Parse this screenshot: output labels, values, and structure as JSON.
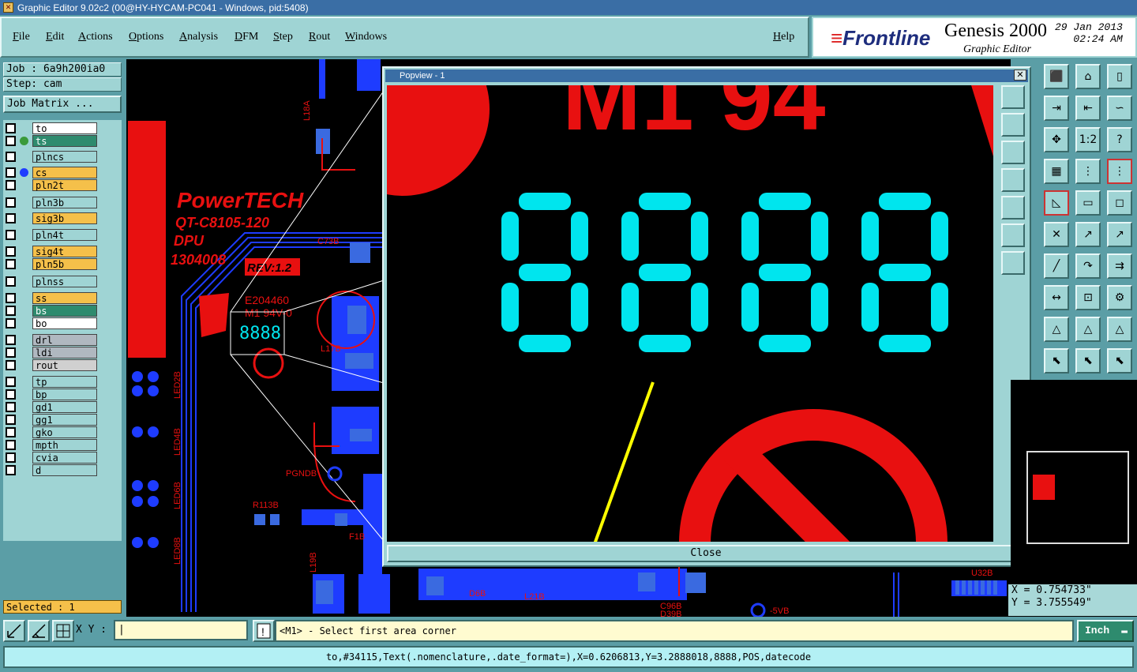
{
  "window": {
    "title": "Graphic Editor 9.02c2 (00@HY-HYCAM-PC041 - Windows, pid:5408)"
  },
  "menu": [
    "File",
    "Edit",
    "Actions",
    "Options",
    "Analysis",
    "DFM",
    "Step",
    "Rout",
    "Windows"
  ],
  "help": "Help",
  "brand": {
    "logo": "Frontline",
    "product": "Genesis 2000",
    "subtitle": "Graphic Editor",
    "date": "29 Jan 2013",
    "time": "02:24 AM"
  },
  "job": {
    "job": "Job : 6a9h200ia0",
    "step": "Step: cam",
    "matrix_btn": "Job Matrix ..."
  },
  "layers": [
    {
      "name": "to",
      "bg": "#ffffff",
      "dot": "none"
    },
    {
      "name": "ts",
      "bg": "#2e8b6e",
      "dot": "#3a9a3a"
    },
    {
      "name": "plncs",
      "bg": "#9fd4d4",
      "dot": "none"
    },
    {
      "name": "cs",
      "bg": "#f5c04a",
      "dot": "#1e3cff"
    },
    {
      "name": "pln2t",
      "bg": "#f5c04a",
      "dot": "none"
    },
    {
      "name": "pln3b",
      "bg": "#9fd4d4",
      "dot": "none"
    },
    {
      "name": "sig3b",
      "bg": "#f5c04a",
      "dot": "none"
    },
    {
      "name": "pln4t",
      "bg": "#9fd4d4",
      "dot": "none"
    },
    {
      "name": "sig4t",
      "bg": "#f5c04a",
      "dot": "none"
    },
    {
      "name": "pln5b",
      "bg": "#f5c04a",
      "dot": "none"
    },
    {
      "name": "plnss",
      "bg": "#9fd4d4",
      "dot": "none"
    },
    {
      "name": "ss",
      "bg": "#f5c04a",
      "dot": "none"
    },
    {
      "name": "bs",
      "bg": "#2e8b6e",
      "dot": "none"
    },
    {
      "name": "bo",
      "bg": "#ffffff",
      "dot": "none"
    },
    {
      "name": "drl",
      "bg": "#b0b8c0",
      "dot": "none"
    },
    {
      "name": "ldi",
      "bg": "#b0b8c0",
      "dot": "none"
    },
    {
      "name": "rout",
      "bg": "#d0d0d0",
      "dot": "none"
    },
    {
      "name": "tp",
      "bg": "#9fd4d4",
      "dot": "none"
    },
    {
      "name": "bp",
      "bg": "#9fd4d4",
      "dot": "none"
    },
    {
      "name": "gd1",
      "bg": "#9fd4d4",
      "dot": "none"
    },
    {
      "name": "gg1",
      "bg": "#9fd4d4",
      "dot": "none"
    },
    {
      "name": "gko",
      "bg": "#9fd4d4",
      "dot": "none"
    },
    {
      "name": "mpth",
      "bg": "#9fd4d4",
      "dot": "none"
    },
    {
      "name": "cvia",
      "bg": "#9fd4d4",
      "dot": "none"
    },
    {
      "name": "d",
      "bg": "#9fd4d4",
      "dot": "none"
    }
  ],
  "selected": "Selected : 1",
  "pcb": {
    "brand_text": "PowerTECH",
    "part_no": "QT-C8105-120",
    "dpu": "DPU",
    "code": "1304008",
    "rev": "REV:1.2",
    "ul_code": "E204460",
    "ul_sub": "M1 94V-0",
    "digits": "8888",
    "labels": [
      "L18A",
      "C73B",
      "L17B",
      "LED2B",
      "LED4B",
      "LED6B",
      "LED8B",
      "PGNDB",
      "R113B",
      "F1B",
      "L19B",
      "D6B",
      "L21B",
      "C96B",
      "D39B",
      "-5VB",
      "U32B"
    ]
  },
  "popview": {
    "title": "Popview - 1",
    "close": "Close",
    "zoom_text": "M1 94",
    "digits": "8888"
  },
  "coords": {
    "x": "X = 0.754733\"",
    "y": "Y = 3.755549\""
  },
  "xy_label": "X Y :",
  "prompt": "<M1> - Select first area corner",
  "unit": "Inch",
  "status": "to,#34115,Text(.nomenclature,.date_format=),X=0.6206813,Y=3.2888018,8888,POS,datecode",
  "colors": {
    "copper": "#e81010",
    "trace": "#1e3cff",
    "highlight": "#00e5ee",
    "pointer": "#ffff00"
  }
}
